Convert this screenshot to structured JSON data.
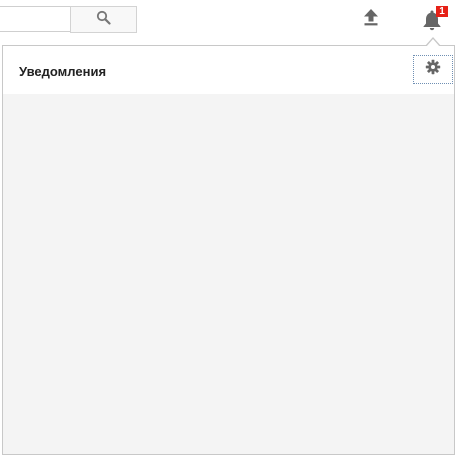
{
  "search": {
    "value": "",
    "placeholder": ""
  },
  "header": {
    "search_button_icon": "search-icon",
    "upload_icon": "upload-icon",
    "notifications_icon": "bell-icon",
    "notification_count": "1"
  },
  "notifications_panel": {
    "title": "Уведомления",
    "settings_icon": "gear-icon"
  },
  "colors": {
    "badge": "#e62117",
    "panel_background": "#f4f4f4",
    "icon": "#666666"
  }
}
